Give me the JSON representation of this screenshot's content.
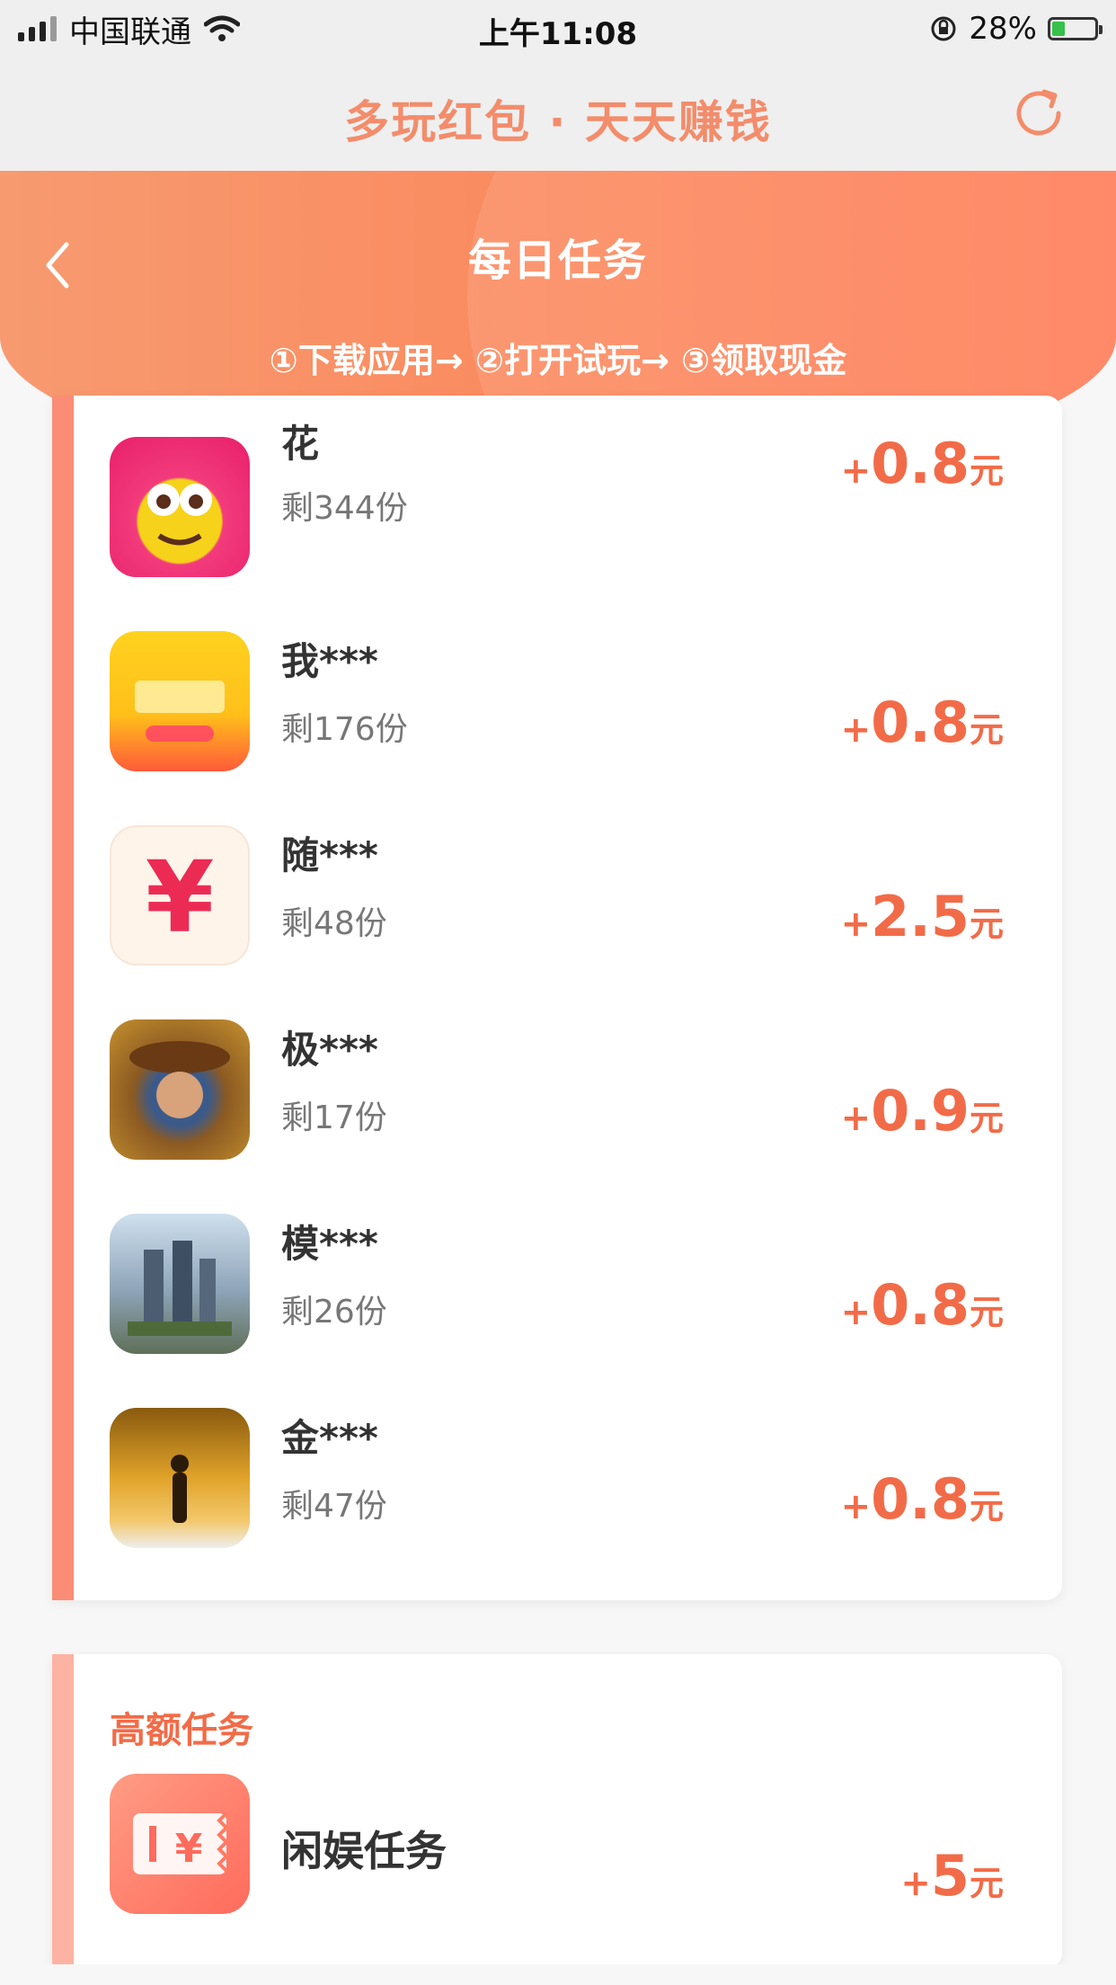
{
  "status_bar": {
    "carrier": "中国联通",
    "time": "上午11:08",
    "battery": "28%"
  },
  "header": {
    "title": "多玩红包 · 天天赚钱",
    "refresh_icon": "refresh-icon"
  },
  "banner": {
    "title": "每日任务",
    "steps": "①下载应用→ ②打开试玩→ ③领取现金",
    "back_icon": "chevron-left-icon"
  },
  "tasks": [
    {
      "name": "花",
      "remaining": "剩344份",
      "reward_plus": "+",
      "reward_amount": "0.8",
      "reward_unit": "元"
    },
    {
      "name": "我***",
      "remaining": "剩176份",
      "reward_plus": "+",
      "reward_amount": "0.8",
      "reward_unit": "元"
    },
    {
      "name": "随***",
      "remaining": "剩48份",
      "reward_plus": "+",
      "reward_amount": "2.5",
      "reward_unit": "元"
    },
    {
      "name": "极***",
      "remaining": "剩17份",
      "reward_plus": "+",
      "reward_amount": "0.9",
      "reward_unit": "元"
    },
    {
      "name": "模***",
      "remaining": "剩26份",
      "reward_plus": "+",
      "reward_amount": "0.8",
      "reward_unit": "元"
    },
    {
      "name": "金***",
      "remaining": "剩47份",
      "reward_plus": "+",
      "reward_amount": "0.8",
      "reward_unit": "元"
    }
  ],
  "high_tasks": {
    "section_title": "高额任务",
    "item": {
      "name": "闲娱任务",
      "reward_plus": "+",
      "reward_amount": "5",
      "reward_unit": "元",
      "icon_symbol": "¥"
    }
  },
  "colors": {
    "accent": "#f26b48",
    "banner_start": "#f79a70",
    "banner_end": "#ff7c58",
    "side_bar": "#fb8c75"
  }
}
